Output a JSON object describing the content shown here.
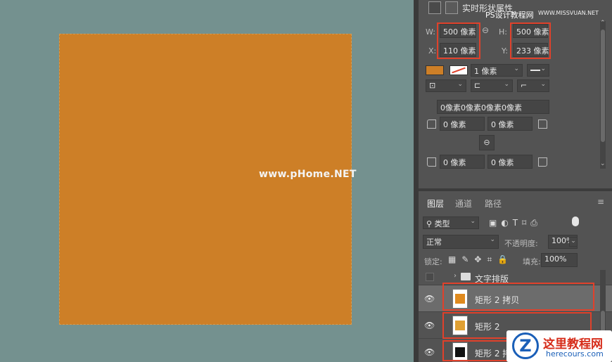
{
  "colors": {
    "shape_fill": "#cd7f27",
    "canvas_bg": "#74918f",
    "highlight": "#e0412b",
    "panel_bg": "#535353"
  },
  "canvas": {
    "watermark": "www.pHome.NET"
  },
  "properties": {
    "title": "实时形状属性",
    "site_watermark": "PS设计教程网",
    "site_watermark_url": "WWW.MISSVUAN.NET",
    "w_label": "W:",
    "w_value": "500 像素",
    "h_label": "H:",
    "h_value": "500 像素",
    "x_label": "X:",
    "x_value": "110 像素",
    "y_label": "Y:",
    "y_value": "233 像素",
    "stroke_width": "1 像素",
    "corner_all": "0像素0像素0像素0像素",
    "corner_tl": "0 像素",
    "corner_tr": "0 像素",
    "corner_bl": "0 像素",
    "corner_br": "0 像素"
  },
  "layers_panel": {
    "tabs": [
      "图层",
      "通道",
      "路径"
    ],
    "filter_kind": "类型",
    "blend_mode": "正常",
    "opacity_label": "不透明度:",
    "opacity_value": "100%",
    "lock_label": "锁定:",
    "fill_label": "填充:",
    "fill_value": "100%",
    "group_name": "文字排版",
    "layers": [
      {
        "name": "矩形 2 拷贝",
        "thumb_color": "#e08a1e"
      },
      {
        "name": "矩形 2",
        "thumb_color": "#e0a032"
      },
      {
        "name": "矩形 2 拷贝",
        "thumb_color": "#111111"
      }
    ]
  },
  "logo": {
    "letter": "Z",
    "title": "这里教程网",
    "url": "herecours.com"
  }
}
